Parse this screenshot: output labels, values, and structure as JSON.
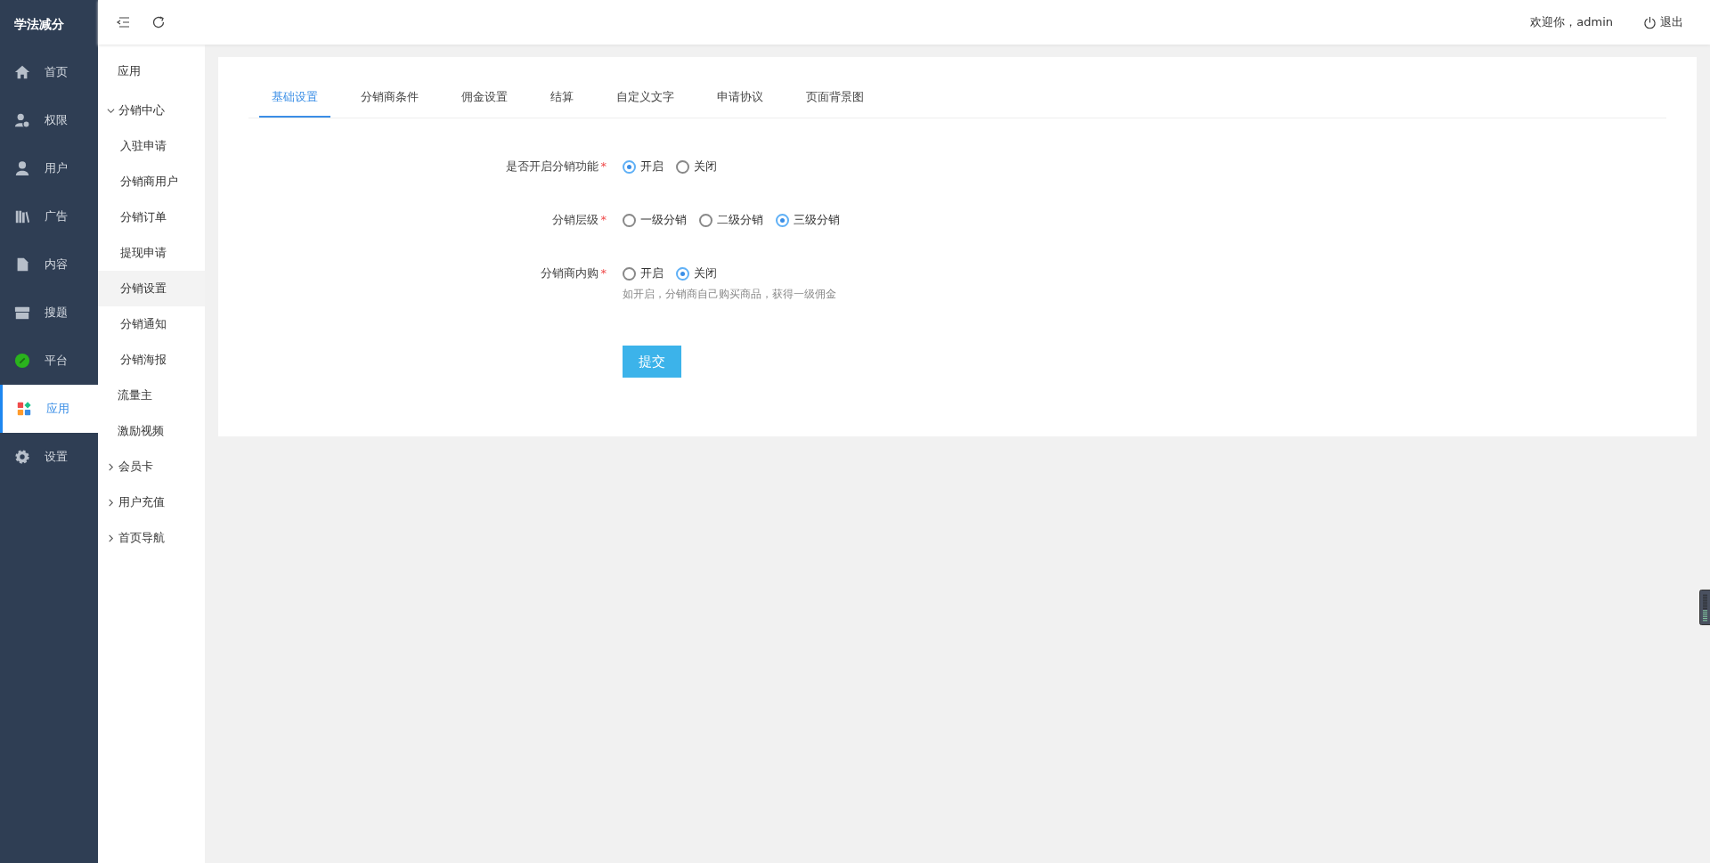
{
  "brand": "学法减分",
  "main_menu": [
    {
      "label": "首页",
      "selected": false
    },
    {
      "label": "权限",
      "selected": false
    },
    {
      "label": "用户",
      "selected": false
    },
    {
      "label": "广告",
      "selected": false
    },
    {
      "label": "内容",
      "selected": false
    },
    {
      "label": "搜题",
      "selected": false
    },
    {
      "label": "平台",
      "selected": false
    },
    {
      "label": "应用",
      "selected": true
    },
    {
      "label": "设置",
      "selected": false
    }
  ],
  "sub_menu": {
    "title": "应用",
    "items": [
      {
        "label": "分销中心",
        "expanded": true,
        "children": [
          {
            "label": "入驻申请",
            "selected": false
          },
          {
            "label": "分销商用户",
            "selected": false
          },
          {
            "label": "分销订单",
            "selected": false
          },
          {
            "label": "提现申请",
            "selected": false
          },
          {
            "label": "分销设置",
            "selected": true
          },
          {
            "label": "分销通知",
            "selected": false
          },
          {
            "label": "分销海报",
            "selected": false
          }
        ]
      },
      {
        "label": "流量主",
        "selected": false
      },
      {
        "label": "激励视频",
        "selected": false
      },
      {
        "label": "会员卡",
        "expanded": false
      },
      {
        "label": "用户充值",
        "expanded": false
      },
      {
        "label": "首页导航",
        "expanded": false
      }
    ]
  },
  "header": {
    "welcome": "欢迎你，admin",
    "logout": "退出"
  },
  "tabs": [
    {
      "label": "基础设置",
      "selected": true
    },
    {
      "label": "分销商条件",
      "selected": false
    },
    {
      "label": "佣金设置",
      "selected": false
    },
    {
      "label": "结算",
      "selected": false
    },
    {
      "label": "自定义文字",
      "selected": false
    },
    {
      "label": "申请协议",
      "selected": false
    },
    {
      "label": "页面背景图",
      "selected": false
    }
  ],
  "form": {
    "fields": [
      {
        "label": "是否开启分销功能",
        "required_mark": "*",
        "options": [
          {
            "label": "开启",
            "selected": true
          },
          {
            "label": "关闭",
            "selected": false
          }
        ]
      },
      {
        "label": "分销层级",
        "required_mark": "*",
        "options": [
          {
            "label": "一级分销",
            "selected": false
          },
          {
            "label": "二级分销",
            "selected": false
          },
          {
            "label": "三级分销",
            "selected": true
          }
        ]
      },
      {
        "label": "分销商内购",
        "required_mark": "*",
        "options": [
          {
            "label": "开启",
            "selected": false
          },
          {
            "label": "关闭",
            "selected": true
          }
        ],
        "hint": "如开启，分销商自己购买商品，获得一级佣金"
      }
    ],
    "submit": "提交"
  }
}
